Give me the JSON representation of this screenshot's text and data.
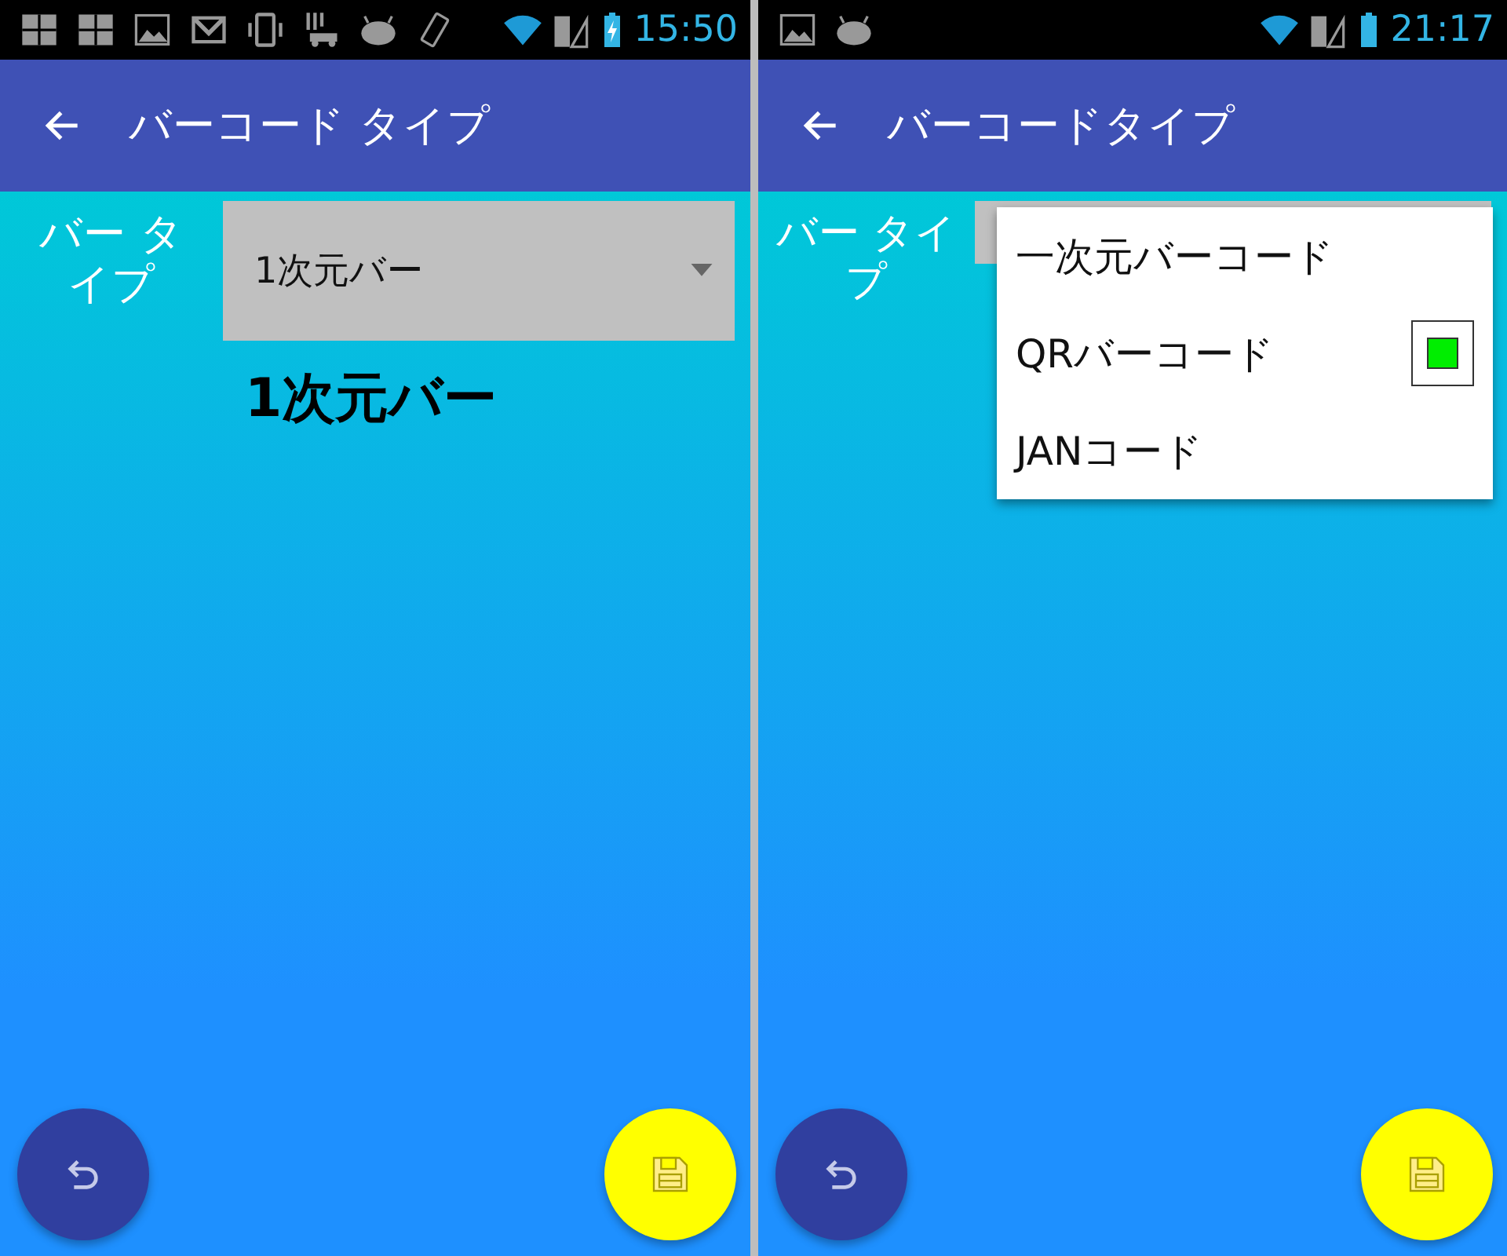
{
  "screens": [
    {
      "status_bar": {
        "icons": [
          {
            "kind": "grid"
          },
          {
            "kind": "grid"
          },
          {
            "kind": "image"
          },
          {
            "kind": "mail"
          },
          {
            "kind": "vibrate"
          },
          {
            "kind": "car"
          },
          {
            "kind": "android"
          },
          {
            "kind": "rotate"
          }
        ],
        "charging": true,
        "time": "15:50"
      },
      "app_bar": {
        "title": "バーコード タイプ"
      },
      "form": {
        "label": "バー タイプ",
        "spinner": {
          "value": "1次元バー",
          "expanded": false
        },
        "result": "1次元バー"
      }
    },
    {
      "status_bar": {
        "icons": [
          {
            "kind": "image"
          },
          {
            "kind": "android"
          }
        ],
        "charging": false,
        "time": "21:17"
      },
      "app_bar": {
        "title": "バーコードタイプ"
      },
      "form": {
        "label": "バー タイプ",
        "spinner": {
          "expanded": true
        },
        "menu": [
          {
            "label": "一次元バーコード",
            "selected": false
          },
          {
            "label": "QRバーコード",
            "selected": true
          },
          {
            "label": "JANコード",
            "selected": false
          }
        ]
      }
    }
  ]
}
